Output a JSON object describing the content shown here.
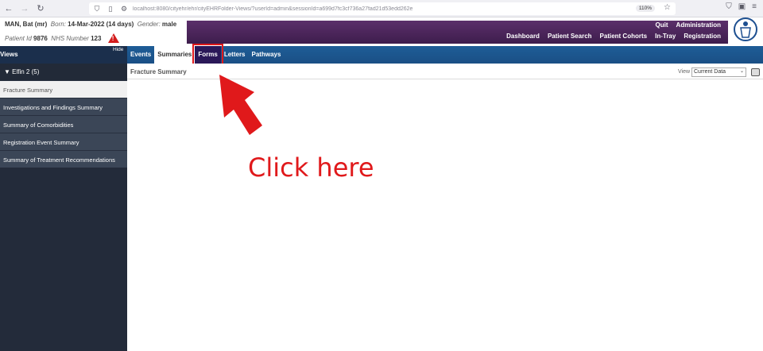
{
  "browser": {
    "url": "localhost:8080/cityehr/ehr/cityEHRFolder-Views/?userId=admin&sessionId=a699d7fc3cf736a27fad21d53edd262e",
    "zoom": "110%"
  },
  "patient": {
    "name": "MAN,  Bat  (mr)",
    "born_label": "Born:",
    "born_value": "14-Mar-2022  (14 days)",
    "gender_label": "Gender:",
    "gender_value": "male",
    "id_label": "Patient Id",
    "id_value": "9876",
    "nhs_label": "NHS Number",
    "nhs_value": "123"
  },
  "topnav": {
    "row1": [
      "Quit",
      "Administration"
    ],
    "row2": [
      "Dashboard",
      "Patient Search",
      "Patient Cohorts",
      "In-Tray",
      "Registration"
    ]
  },
  "views_label": "Views",
  "hide_label": "Hide",
  "tabs": [
    "Events",
    "Summaries",
    "Forms",
    "Letters",
    "Pathways"
  ],
  "sidebar": {
    "group": "▼ Elfin 2 (5)",
    "items": [
      "Fracture Summary",
      "Investigations and Findings Summary",
      "Summary of Comorbidities",
      "Registration Event Summary",
      "Summary of Treatment Recommendations"
    ]
  },
  "main": {
    "title": "Fracture Summary",
    "view_label": "View",
    "view_value": "Current Data"
  },
  "annotation": {
    "text": "Click here",
    "color": "#e0191b"
  },
  "colors": {
    "topnav": "#4a2459",
    "band": "#1e5d97",
    "sidebar": "#232b3a"
  }
}
